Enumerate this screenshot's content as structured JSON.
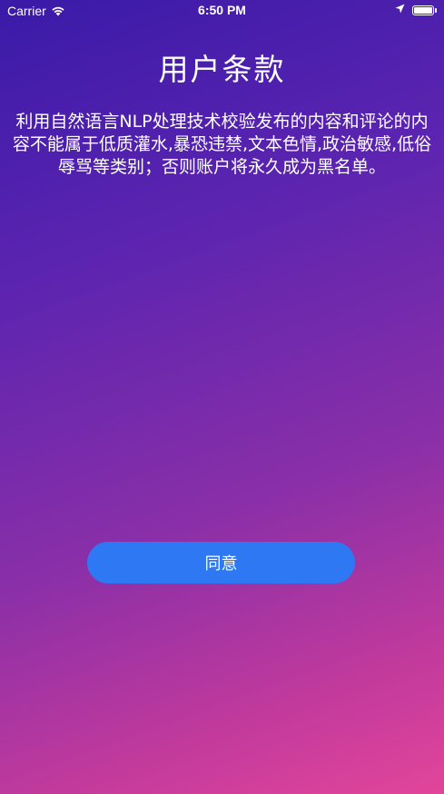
{
  "status_bar": {
    "carrier": "Carrier",
    "time": "6:50 PM",
    "battery_level": 1.0,
    "icons": [
      "wifi-icon",
      "location-arrow-icon",
      "battery-icon"
    ]
  },
  "page": {
    "title": "用户条款",
    "body": "利用自然语言NLP处理技术校验发布的内容和评论的内容不能属于低质灌水,暴恐违禁,文本色情,政治敏感,低俗辱骂等类别；否则账户将永久成为黑名单。",
    "agree_button_label": "同意"
  },
  "colors": {
    "gradient_start": "#3a1aa8",
    "gradient_end": "#e2459a",
    "button": "#2f78f4",
    "text": "#ffffff"
  }
}
